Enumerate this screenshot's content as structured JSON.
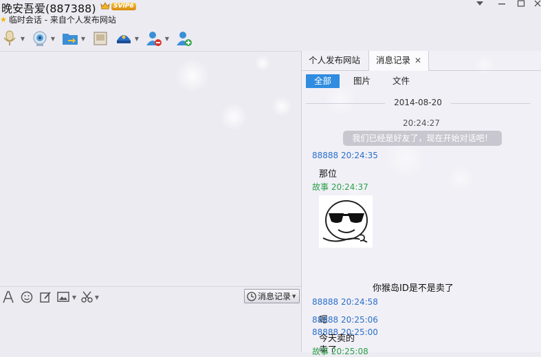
{
  "window": {
    "title": "晚安吾爱(887388)",
    "badge": "SVIP6",
    "subtitle": "临时会话 - 来自个人发布网站"
  },
  "toolbar": {
    "icons": [
      "microphone-icon",
      "video-camera-icon",
      "file-transfer-icon",
      "screen-share-icon",
      "app-center-icon",
      "remove-user-icon",
      "add-user-icon"
    ]
  },
  "input_toolbar": {
    "history_label": "消息记录"
  },
  "right_panel": {
    "tabs": [
      {
        "label": "个人发布网站",
        "active": false
      },
      {
        "label": "消息记录",
        "active": true
      }
    ],
    "filters": [
      {
        "label": "全部",
        "active": true
      },
      {
        "label": "图片",
        "active": false
      },
      {
        "label": "文件",
        "active": false
      }
    ],
    "date": "2014-08-20",
    "system_time": "20:24:27",
    "system_message": "我们已经是好友了，现在开始对话吧！",
    "messages": [
      {
        "sender": "88888",
        "time": "20:24:35",
        "text": "那位",
        "color": "#2a6fc9"
      },
      {
        "sender": "故事",
        "time": "20:24:37",
        "text": "你猴岛ID是不是卖了",
        "color": "#2aa04a",
        "sticker": "sunglasses-smiley-sticker"
      },
      {
        "sender": "88888",
        "time": "20:24:58",
        "text": "嗯",
        "color": "#2a6fc9"
      },
      {
        "sender": "88888",
        "time": "20:25:00",
        "text": "卖了",
        "color": "#2a6fc9"
      },
      {
        "sender": "88888",
        "time": "20:25:06",
        "text": "今天卖的",
        "color": "#2a6fc9"
      },
      {
        "sender": "故事",
        "time": "20:25:08",
        "text": "",
        "color": "#2aa04a"
      }
    ]
  },
  "colors": {
    "accent": "#2f8ce0",
    "self_name": "#2a6fc9",
    "peer_name": "#2aa04a"
  }
}
